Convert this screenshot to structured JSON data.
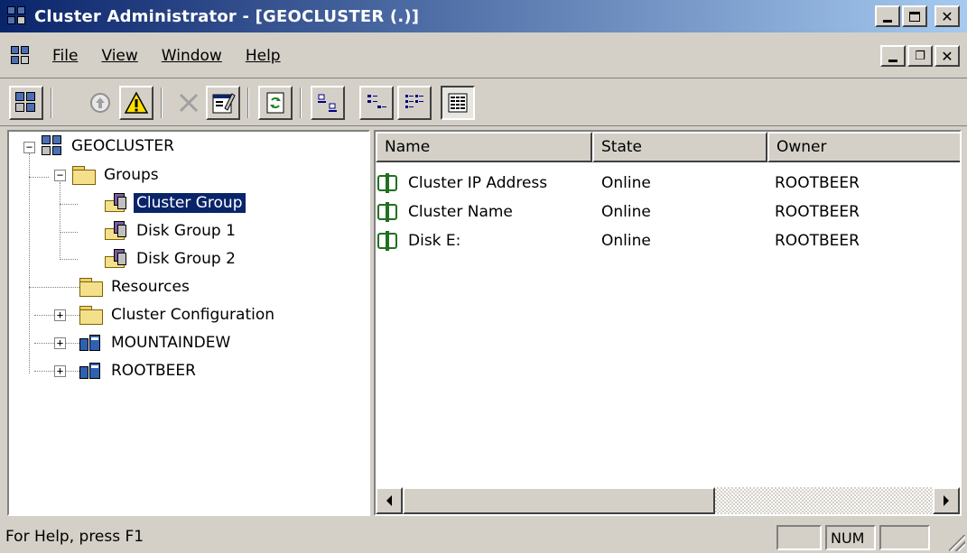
{
  "window": {
    "title": "Cluster Administrator - [GEOCLUSTER (.)]",
    "caption_buttons": [
      "minimize",
      "maximize",
      "close"
    ]
  },
  "menu": {
    "items": [
      {
        "label": "File"
      },
      {
        "label": "View"
      },
      {
        "label": "Window"
      },
      {
        "label": "Help"
      }
    ]
  },
  "toolbar": {
    "buttons": [
      "open-connection-icon",
      "bring-online-icon",
      "take-offline-icon",
      "delete-icon",
      "properties-icon",
      "refresh-icon",
      "large-icons-icon",
      "small-icons-icon",
      "list-icon",
      "details-icon"
    ],
    "pressed": "details-icon"
  },
  "tree": {
    "root": "GEOCLUSTER",
    "groups": "Groups",
    "cluster_group": "Cluster Group",
    "disk_group_1": "Disk Group 1",
    "disk_group_2": "Disk Group 2",
    "resources": "Resources",
    "cluster_configuration": "Cluster Configuration",
    "node_1": "MOUNTAINDEW",
    "node_2": "ROOTBEER",
    "selected": "Cluster Group"
  },
  "list": {
    "columns": {
      "name": "Name",
      "state": "State",
      "owner": "Owner"
    },
    "rows": [
      {
        "name": "Cluster IP Address",
        "state": "Online",
        "owner": "ROOTBEER"
      },
      {
        "name": "Cluster Name",
        "state": "Online",
        "owner": "ROOTBEER"
      },
      {
        "name": "Disk E:",
        "state": "Online",
        "owner": "ROOTBEER"
      }
    ]
  },
  "statusbar": {
    "help_text": "For Help, press F1",
    "num_indicator": "NUM"
  },
  "colors": {
    "titlebar_start": "#0a246a",
    "titlebar_end": "#a6caf0",
    "selection": "#0a246a",
    "face": "#d4d0c8"
  }
}
